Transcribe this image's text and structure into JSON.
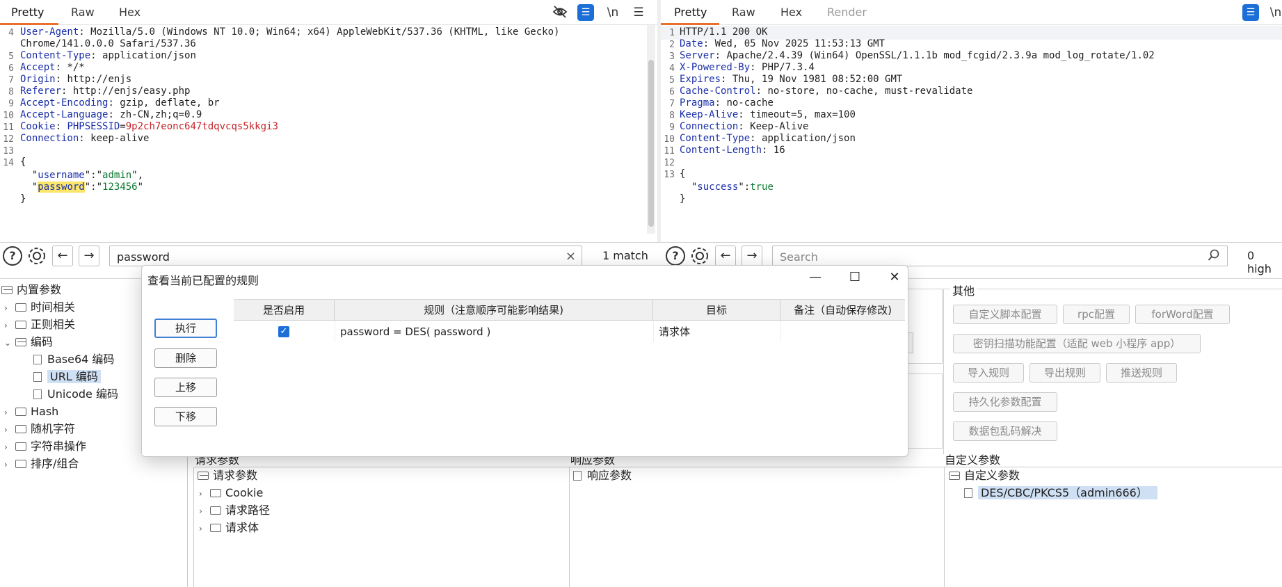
{
  "request_pane": {
    "tabs": [
      "Pretty",
      "Raw",
      "Hex"
    ],
    "toolbar": {
      "hide_icon": "eye-off-icon",
      "wrap_icon": "wrap-icon",
      "newline_label": "\\n",
      "menu_icon": "menu-icon"
    },
    "lines": [
      {
        "n": "4",
        "key": "User-Agent",
        "sep": ": ",
        "val": "Mozilla/5.0 (Windows NT 10.0; Win64; x64) AppleWebKit/537.36 (KHTML, like Gecko)"
      },
      {
        "n": "",
        "key": "",
        "sep": "",
        "val": "Chrome/141.0.0.0 Safari/537.36"
      },
      {
        "n": "5",
        "key": "Content-Type",
        "sep": ": ",
        "val": "application/json"
      },
      {
        "n": "6",
        "key": "Accept",
        "sep": ": ",
        "val": "*/*"
      },
      {
        "n": "7",
        "key": "Origin",
        "sep": ": ",
        "val": "http://enjs"
      },
      {
        "n": "8",
        "key": "Referer",
        "sep": ": ",
        "val": "http://enjs/easy.php"
      },
      {
        "n": "9",
        "key": "Accept-Encoding",
        "sep": ": ",
        "val": "gzip, deflate, br"
      },
      {
        "n": "10",
        "key": "Accept-Language",
        "sep": ": ",
        "val": "zh-CN,zh;q=0.9"
      },
      {
        "n": "11",
        "key": "Cookie",
        "sep": ": ",
        "cookie_name": "PHPSESSID",
        "cookie_eq": "=",
        "cookie_val": "9p2ch7eonc647tdqvcqs5kkgi3"
      },
      {
        "n": "12",
        "key": "Connection",
        "sep": ": ",
        "val": "keep-alive"
      },
      {
        "n": "13",
        "key": "",
        "sep": "",
        "val": ""
      },
      {
        "n": "14",
        "key": "",
        "sep": "",
        "val": "{"
      }
    ],
    "json_lines": [
      {
        "pre": "  \"",
        "key": "username",
        "mid": "\":\"",
        "val": "admin",
        "post": "\","
      },
      {
        "pre": "  \"",
        "key": "password",
        "mid": "\":\"",
        "val": "123456",
        "post": "\""
      }
    ],
    "close_brace": "}"
  },
  "response_pane": {
    "tabs": [
      "Pretty",
      "Raw",
      "Hex",
      "Render"
    ],
    "toolbar": {
      "wrap_icon": "wrap-icon",
      "newline_label": "\\n"
    },
    "status_line": {
      "n": "1",
      "val": "HTTP/1.1 200 OK"
    },
    "lines": [
      {
        "n": "2",
        "key": "Date",
        "sep": ": ",
        "val": "Wed, 05 Nov 2025 11:53:13 GMT"
      },
      {
        "n": "3",
        "key": "Server",
        "sep": ": ",
        "val": "Apache/2.4.39 (Win64) OpenSSL/1.1.1b mod_fcgid/2.3.9a mod_log_rotate/1.02"
      },
      {
        "n": "4",
        "key": "X-Powered-By",
        "sep": ": ",
        "val": "PHP/7.3.4"
      },
      {
        "n": "5",
        "key": "Expires",
        "sep": ": ",
        "val": "Thu, 19 Nov 1981 08:52:00 GMT"
      },
      {
        "n": "6",
        "key": "Cache-Control",
        "sep": ": ",
        "val": "no-store, no-cache, must-revalidate"
      },
      {
        "n": "7",
        "key": "Pragma",
        "sep": ": ",
        "val": "no-cache"
      },
      {
        "n": "8",
        "key": "Keep-Alive",
        "sep": ": ",
        "val": "timeout=5, max=100"
      },
      {
        "n": "9",
        "key": "Connection",
        "sep": ": ",
        "val": "Keep-Alive"
      },
      {
        "n": "10",
        "key": "Content-Type",
        "sep": ": ",
        "val": "application/json"
      },
      {
        "n": "11",
        "key": "Content-Length",
        "sep": ": ",
        "val": "16"
      },
      {
        "n": "12",
        "key": "",
        "sep": "",
        "val": ""
      },
      {
        "n": "13",
        "key": "",
        "sep": "",
        "val": "{"
      }
    ],
    "json_line": {
      "pre": "  \"",
      "key": "success",
      "mid": "\":",
      "val": "true"
    },
    "close_brace": "}"
  },
  "search_left": {
    "value": "password",
    "match_label": "1 match",
    "help_label": "?",
    "settings_icon": "gear-icon",
    "prev_label": "←",
    "next_label": "→",
    "clear_label": "×"
  },
  "search_right": {
    "placeholder": "Search",
    "match_label": "0 high",
    "help_label": "?",
    "prev_label": "←",
    "next_label": "→"
  },
  "builtin_tree": {
    "root": "内置参数",
    "items": [
      "时间相关",
      "正则相关",
      "编码",
      "Base64 编码",
      "URL 编码",
      "Unicode 编码",
      "Hash",
      "随机字符",
      "字符串操作",
      "排序/组合"
    ]
  },
  "other_group": {
    "title": "其他",
    "buttons": [
      "自定义脚本配置",
      "rpc配置",
      "forWord配置",
      "密钥扫描功能配置（适配 web 小程序 app）",
      "导入规则",
      "导出规则",
      "推送规则",
      "持久化参数配置",
      "数据包乱码解决"
    ]
  },
  "request_params": {
    "label": "请求参数",
    "root": "请求参数",
    "children": [
      "Cookie",
      "请求路径",
      "请求体"
    ]
  },
  "response_params": {
    "label": "响应参数",
    "root": "响应参数"
  },
  "custom_params": {
    "label": "自定义参数",
    "root": "自定义参数",
    "item": "DES/CBC/PKCS5（admin666）"
  },
  "dialog": {
    "title": "查看当前已配置的规则",
    "buttons": {
      "execute": "执行",
      "delete": "删除",
      "move_up": "上移",
      "move_down": "下移"
    },
    "columns": [
      "是否启用",
      "规则（注意顺序可能影响结果)",
      "目标",
      "备注（自动保存修改)"
    ],
    "rows": [
      {
        "enabled": true,
        "rule": "password = DES( password )",
        "target": "请求体",
        "note": ""
      }
    ],
    "controls": {
      "minimize": "—",
      "maximize": "☐",
      "close": "✕"
    }
  }
}
